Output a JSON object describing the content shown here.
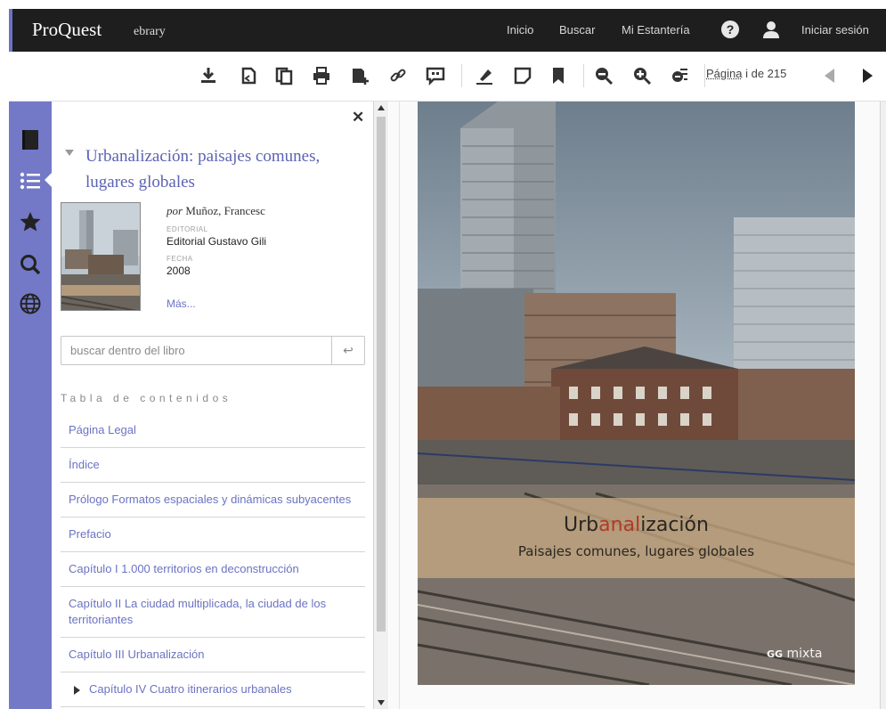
{
  "topbar": {
    "brand": "ProQuest",
    "brand_sub": "ebrary",
    "nav": [
      "Inicio",
      "Buscar",
      "Mi Estantería"
    ],
    "help_icon": "help-circle-icon",
    "user_icon": "user-icon",
    "login": "Iniciar sesión"
  },
  "toolbar": {
    "icons": [
      "download-icon",
      "copy-pages-icon",
      "copy-text-icon",
      "print-icon",
      "add-to-shelf-icon",
      "link-icon",
      "citation-icon",
      "highlight-icon",
      "note-icon",
      "bookmark-icon",
      "zoom-out-icon",
      "zoom-in-icon",
      "fit-page-icon",
      "previous-page-icon",
      "next-page-icon"
    ],
    "page_word": "Página",
    "page_value": "i de 215"
  },
  "rail": {
    "icons": [
      "book-icon",
      "toc-list-icon",
      "star-icon",
      "search-icon",
      "globe-icon"
    ],
    "active": "toc-list-icon"
  },
  "panel": {
    "title": "Urbanalización: paisajes comunes, lugares globales",
    "by_prefix": "por",
    "author": "Muñoz, Francesc",
    "publisher_label": "EDITORIAL",
    "publisher": "Editorial Gustavo Gili",
    "date_label": "FECHA",
    "date": "2008",
    "more": "Más...",
    "search_placeholder": "buscar dentro del libro",
    "toc_heading": "Tabla de contenidos",
    "toc": [
      "Página Legal",
      "Índice",
      "Prólogo Formatos espaciales y dinámicas subyacentes",
      "Prefacio",
      "Capítulo I 1.000 territorios en deconstrucción",
      "Capítulo II La ciudad multiplicada, la ciudad de los territoriantes",
      "Capítulo III Urbanalización",
      "Capítulo IV Cuatro itinerarios urbanales"
    ]
  },
  "cover": {
    "title_pre": "Urb",
    "title_accent": "anal",
    "title_post": "ización",
    "subtitle": "Paisajes comunes, lugares globales",
    "publisher_gg": "GG",
    "publisher_name": "mixta"
  }
}
